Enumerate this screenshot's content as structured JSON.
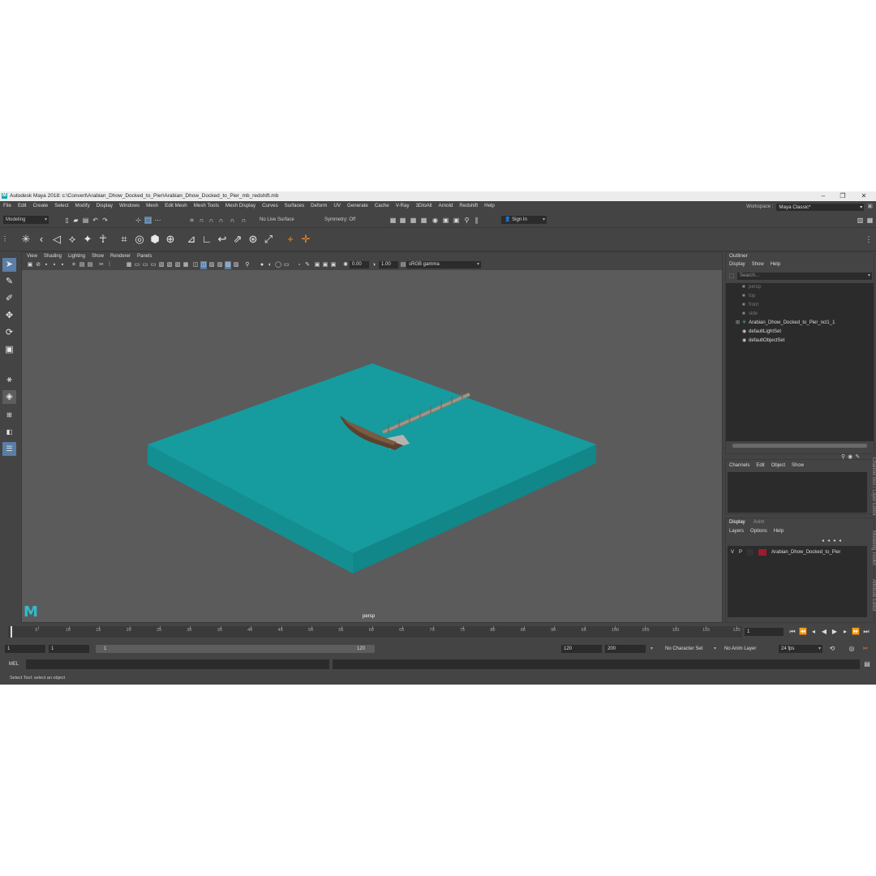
{
  "title": "Autodesk Maya 2018: c:\\Convert\\Arabian_Dhow_Docked_to_Pier\\Arabian_Dhow_Docked_to_Pier_mb_redshift.mb",
  "menu": [
    "File",
    "Edit",
    "Create",
    "Select",
    "Modify",
    "Display",
    "Windows",
    "Mesh",
    "Edit Mesh",
    "Mesh Tools",
    "Mesh Display",
    "Curves",
    "Surfaces",
    "Deform",
    "UV",
    "Generate",
    "Cache",
    "V-Ray",
    "3DtoAll",
    "Arnold",
    "Redshift",
    "Help"
  ],
  "workspace": {
    "label": "Workspace :",
    "value": "Maya Classic*"
  },
  "status": {
    "mode": "Modeling",
    "live_surface": "No Live Surface",
    "symmetry": "Symmetry: Off",
    "sign_in": "Sign In"
  },
  "viewport": {
    "menu": [
      "View",
      "Shading",
      "Lighting",
      "Show",
      "Renderer",
      "Panels"
    ],
    "exposure": "0.00",
    "gamma": "1.00",
    "color_space": "sRGB gamma",
    "camera": "persp"
  },
  "outliner": {
    "title": "Outliner",
    "menu": [
      "Display",
      "Show",
      "Help"
    ],
    "search_placeholder": "Search...",
    "items": [
      {
        "label": "persp",
        "dim": true
      },
      {
        "label": "top",
        "dim": true
      },
      {
        "label": "front",
        "dim": true
      },
      {
        "label": "side",
        "dim": true
      },
      {
        "label": "Arabian_Dhow_Docked_to_Pier_ncl1_1",
        "dim": false
      },
      {
        "label": "defaultLightSet",
        "dim": false
      },
      {
        "label": "defaultObjectSet",
        "dim": false
      }
    ]
  },
  "channel_box": {
    "menu": [
      "Channels",
      "Edit",
      "Object",
      "Show"
    ]
  },
  "layers": {
    "tabs": [
      "Display",
      "Anim"
    ],
    "menu": [
      "Layers",
      "Options",
      "Help"
    ],
    "row": {
      "v": "V",
      "p": "P",
      "name": "Arabian_Dhow_Docked_to_Pier",
      "color": "#9c1b2e"
    }
  },
  "side_tabs": [
    "Channel Box / Layer Editor",
    "Modeling Toolkit",
    "Attribute Editor"
  ],
  "timeline": {
    "ticks": [
      "5",
      "10",
      "15",
      "20",
      "25",
      "30",
      "35",
      "40",
      "45",
      "50",
      "55",
      "60",
      "65",
      "70",
      "75",
      "80",
      "85",
      "90",
      "95",
      "100",
      "105",
      "110",
      "115",
      "120"
    ],
    "current_frame": "1"
  },
  "range": {
    "start": "1",
    "playback_start": "1",
    "slider_start": "1",
    "slider_end": "120",
    "playback_end": "120",
    "end": "200",
    "character_set": "No Character Set",
    "anim_layer": "No Anim Layer",
    "fps": "24 fps"
  },
  "command": {
    "lang": "MEL"
  },
  "help_line": "Select Tool: select an object",
  "colors": {
    "water": "#139a9d",
    "water_top": "#199c9e",
    "water_side": "#118a8d",
    "layer": "#9c1b2e",
    "accent": "#5a7ea6"
  }
}
